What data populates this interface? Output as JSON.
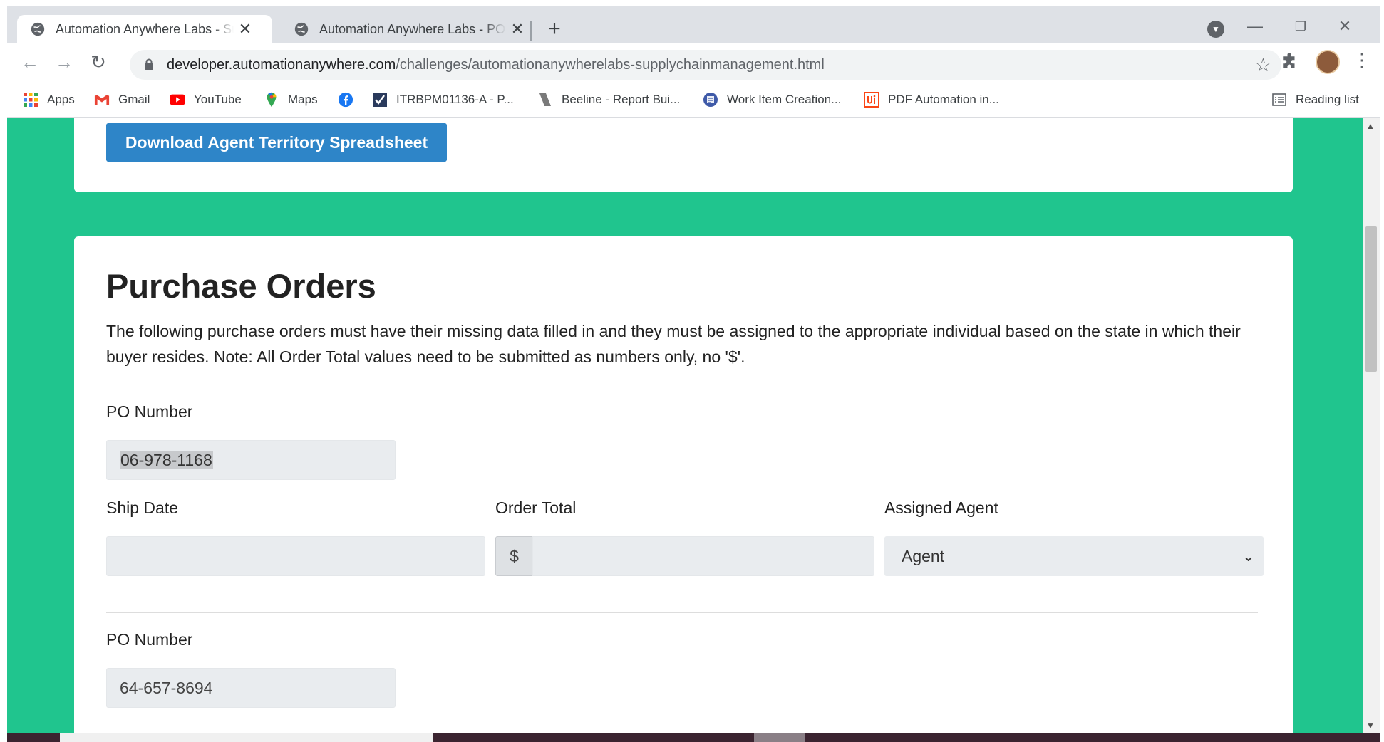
{
  "browser": {
    "tabs": [
      {
        "title": "Automation Anywhere Labs - Supply Chain Management",
        "active": true
      },
      {
        "title": "Automation Anywhere Labs - PO",
        "active": false
      }
    ],
    "new_tab_symbol": "+",
    "url_domain": "developer.automationanywhere.com",
    "url_path": "/challenges/automationanywherelabs-supplychainmanagement.html",
    "icons": {
      "back": "back-arrow-icon",
      "forward": "forward-arrow-icon",
      "reload": "reload-icon",
      "star": "bookmark-star-icon",
      "extensions": "puzzle-icon",
      "menu": "kebab-menu-icon"
    }
  },
  "bookmarks": {
    "items": [
      {
        "label": "Apps",
        "icon": "apps-grid-icon"
      },
      {
        "label": "Gmail",
        "icon": "gmail-icon"
      },
      {
        "label": "YouTube",
        "icon": "youtube-icon"
      },
      {
        "label": "Maps",
        "icon": "maps-pin-icon"
      },
      {
        "label": "",
        "icon": "facebook-icon"
      },
      {
        "label": "ITRBPM01136-A - P...",
        "icon": "itrbpm-icon"
      },
      {
        "label": "Beeline - Report Bui...",
        "icon": "beeline-icon"
      },
      {
        "label": "Work Item Creation...",
        "icon": "work-item-icon"
      },
      {
        "label": "PDF Automation in...",
        "icon": "uipath-icon"
      }
    ],
    "reading_list": "Reading list"
  },
  "page": {
    "download_button": "Download Agent Territory Spreadsheet",
    "section_title": "Purchase Orders",
    "description": "The following purchase orders must have their missing data filled in and they must be assigned to the appropriate individual based on the state in which their buyer resides. Note: All Order Total values need to be submitted as numbers only, no '$'.",
    "orders": [
      {
        "po_label": "PO Number",
        "po_value": "06-978-1168",
        "ship_date_label": "Ship Date",
        "ship_date_value": "",
        "order_total_label": "Order Total",
        "currency_symbol": "$",
        "order_total_value": "",
        "agent_label": "Assigned Agent",
        "agent_value": "Agent"
      },
      {
        "po_label": "PO Number",
        "po_value": "64-657-8694"
      }
    ]
  },
  "colors": {
    "page_background": "#20c58e",
    "button_primary": "#2e85c8",
    "field_background": "#e9ecef"
  }
}
